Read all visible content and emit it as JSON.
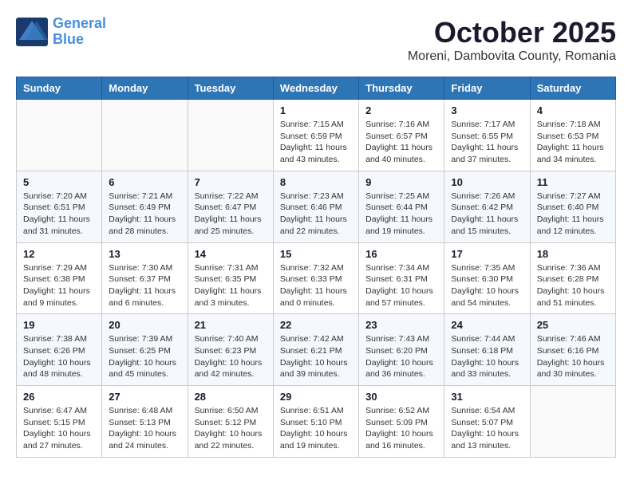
{
  "header": {
    "logo_line1": "General",
    "logo_line2": "Blue",
    "month_title": "October 2025",
    "location": "Moreni, Dambovita County, Romania"
  },
  "weekdays": [
    "Sunday",
    "Monday",
    "Tuesday",
    "Wednesday",
    "Thursday",
    "Friday",
    "Saturday"
  ],
  "weeks": [
    [
      {
        "day": "",
        "info": ""
      },
      {
        "day": "",
        "info": ""
      },
      {
        "day": "",
        "info": ""
      },
      {
        "day": "1",
        "info": "Sunrise: 7:15 AM\nSunset: 6:59 PM\nDaylight: 11 hours\nand 43 minutes."
      },
      {
        "day": "2",
        "info": "Sunrise: 7:16 AM\nSunset: 6:57 PM\nDaylight: 11 hours\nand 40 minutes."
      },
      {
        "day": "3",
        "info": "Sunrise: 7:17 AM\nSunset: 6:55 PM\nDaylight: 11 hours\nand 37 minutes."
      },
      {
        "day": "4",
        "info": "Sunrise: 7:18 AM\nSunset: 6:53 PM\nDaylight: 11 hours\nand 34 minutes."
      }
    ],
    [
      {
        "day": "5",
        "info": "Sunrise: 7:20 AM\nSunset: 6:51 PM\nDaylight: 11 hours\nand 31 minutes."
      },
      {
        "day": "6",
        "info": "Sunrise: 7:21 AM\nSunset: 6:49 PM\nDaylight: 11 hours\nand 28 minutes."
      },
      {
        "day": "7",
        "info": "Sunrise: 7:22 AM\nSunset: 6:47 PM\nDaylight: 11 hours\nand 25 minutes."
      },
      {
        "day": "8",
        "info": "Sunrise: 7:23 AM\nSunset: 6:46 PM\nDaylight: 11 hours\nand 22 minutes."
      },
      {
        "day": "9",
        "info": "Sunrise: 7:25 AM\nSunset: 6:44 PM\nDaylight: 11 hours\nand 19 minutes."
      },
      {
        "day": "10",
        "info": "Sunrise: 7:26 AM\nSunset: 6:42 PM\nDaylight: 11 hours\nand 15 minutes."
      },
      {
        "day": "11",
        "info": "Sunrise: 7:27 AM\nSunset: 6:40 PM\nDaylight: 11 hours\nand 12 minutes."
      }
    ],
    [
      {
        "day": "12",
        "info": "Sunrise: 7:29 AM\nSunset: 6:38 PM\nDaylight: 11 hours\nand 9 minutes."
      },
      {
        "day": "13",
        "info": "Sunrise: 7:30 AM\nSunset: 6:37 PM\nDaylight: 11 hours\nand 6 minutes."
      },
      {
        "day": "14",
        "info": "Sunrise: 7:31 AM\nSunset: 6:35 PM\nDaylight: 11 hours\nand 3 minutes."
      },
      {
        "day": "15",
        "info": "Sunrise: 7:32 AM\nSunset: 6:33 PM\nDaylight: 11 hours\nand 0 minutes."
      },
      {
        "day": "16",
        "info": "Sunrise: 7:34 AM\nSunset: 6:31 PM\nDaylight: 10 hours\nand 57 minutes."
      },
      {
        "day": "17",
        "info": "Sunrise: 7:35 AM\nSunset: 6:30 PM\nDaylight: 10 hours\nand 54 minutes."
      },
      {
        "day": "18",
        "info": "Sunrise: 7:36 AM\nSunset: 6:28 PM\nDaylight: 10 hours\nand 51 minutes."
      }
    ],
    [
      {
        "day": "19",
        "info": "Sunrise: 7:38 AM\nSunset: 6:26 PM\nDaylight: 10 hours\nand 48 minutes."
      },
      {
        "day": "20",
        "info": "Sunrise: 7:39 AM\nSunset: 6:25 PM\nDaylight: 10 hours\nand 45 minutes."
      },
      {
        "day": "21",
        "info": "Sunrise: 7:40 AM\nSunset: 6:23 PM\nDaylight: 10 hours\nand 42 minutes."
      },
      {
        "day": "22",
        "info": "Sunrise: 7:42 AM\nSunset: 6:21 PM\nDaylight: 10 hours\nand 39 minutes."
      },
      {
        "day": "23",
        "info": "Sunrise: 7:43 AM\nSunset: 6:20 PM\nDaylight: 10 hours\nand 36 minutes."
      },
      {
        "day": "24",
        "info": "Sunrise: 7:44 AM\nSunset: 6:18 PM\nDaylight: 10 hours\nand 33 minutes."
      },
      {
        "day": "25",
        "info": "Sunrise: 7:46 AM\nSunset: 6:16 PM\nDaylight: 10 hours\nand 30 minutes."
      }
    ],
    [
      {
        "day": "26",
        "info": "Sunrise: 6:47 AM\nSunset: 5:15 PM\nDaylight: 10 hours\nand 27 minutes."
      },
      {
        "day": "27",
        "info": "Sunrise: 6:48 AM\nSunset: 5:13 PM\nDaylight: 10 hours\nand 24 minutes."
      },
      {
        "day": "28",
        "info": "Sunrise: 6:50 AM\nSunset: 5:12 PM\nDaylight: 10 hours\nand 22 minutes."
      },
      {
        "day": "29",
        "info": "Sunrise: 6:51 AM\nSunset: 5:10 PM\nDaylight: 10 hours\nand 19 minutes."
      },
      {
        "day": "30",
        "info": "Sunrise: 6:52 AM\nSunset: 5:09 PM\nDaylight: 10 hours\nand 16 minutes."
      },
      {
        "day": "31",
        "info": "Sunrise: 6:54 AM\nSunset: 5:07 PM\nDaylight: 10 hours\nand 13 minutes."
      },
      {
        "day": "",
        "info": ""
      }
    ]
  ]
}
